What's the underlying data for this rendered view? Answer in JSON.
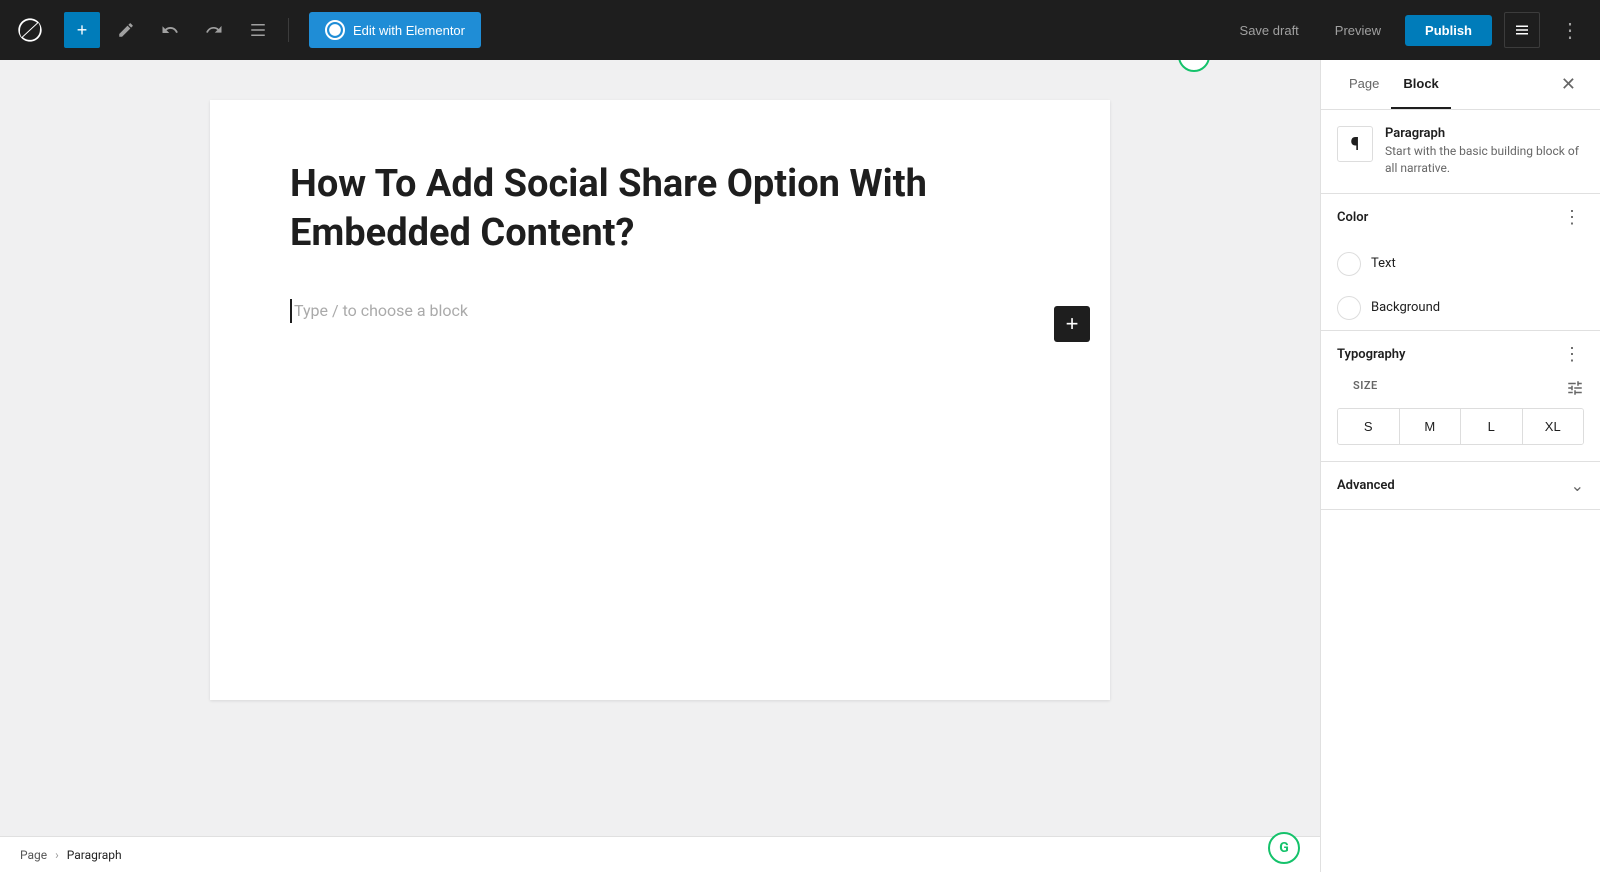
{
  "toolbar": {
    "wp_logo": "W",
    "add_label": "+",
    "edit_btn_label": "Edit with Elementor",
    "elementor_icon": "E",
    "save_draft_label": "Save draft",
    "preview_label": "Preview",
    "publish_label": "Publish"
  },
  "editor": {
    "post_title": "How To Add Social Share Option With Embedded Content?",
    "block_placeholder": "Type / to choose a block"
  },
  "sidebar": {
    "tab_page": "Page",
    "tab_block": "Block",
    "block_info": {
      "name": "Paragraph",
      "description": "Start with the basic building block of all narrative."
    },
    "color": {
      "title": "Color",
      "text_label": "Text",
      "background_label": "Background"
    },
    "typography": {
      "title": "Typography",
      "size_label": "SIZE",
      "sizes": [
        "S",
        "M",
        "L",
        "XL"
      ]
    },
    "advanced": {
      "title": "Advanced"
    }
  },
  "breadcrumb": {
    "page_label": "Page",
    "paragraph_label": "Paragraph"
  }
}
